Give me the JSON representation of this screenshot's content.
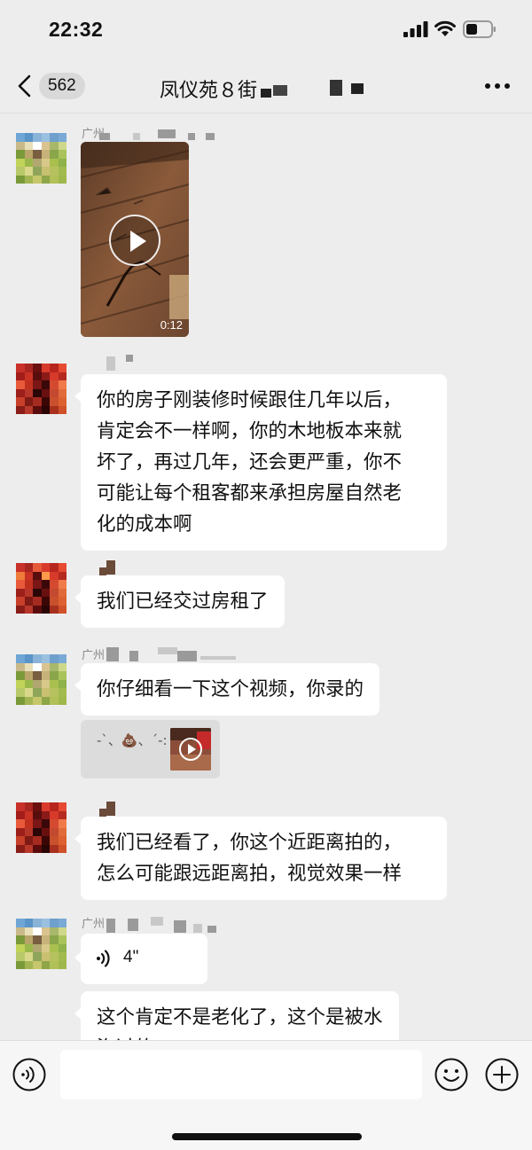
{
  "status_bar": {
    "time": "22:32"
  },
  "header": {
    "unread_count": "562",
    "title": "凤仪苑８街"
  },
  "messages": [
    {
      "kind": "video",
      "sender": "广州",
      "duration": "0:12"
    },
    {
      "kind": "text",
      "lines": [
        "你的房子刚装修时候跟住几年以后，",
        "肯定会不一样啊，你的木地板本来就",
        "坏了，再过几年，还会更严重，你不",
        "可能让每个租客都来承担房屋自然老",
        "化的成本啊"
      ]
    },
    {
      "kind": "text",
      "lines": [
        "我们已经交过房租了"
      ]
    },
    {
      "kind": "text",
      "sender": "广州",
      "lines": [
        "你仔细看一下这个视频，你录的"
      ],
      "quote": "-`、💩、´-:"
    },
    {
      "kind": "text",
      "lines": [
        "我们已经看了，你这个近距离拍的，",
        "怎么可能跟远距离拍，视觉效果一样"
      ]
    },
    {
      "kind": "voice",
      "sender": "广州",
      "duration": "4\""
    },
    {
      "kind": "text",
      "lines": [
        "这个肯定不是老化了，这个是被水",
        "泡过的"
      ]
    }
  ],
  "input": {
    "value": ""
  },
  "colors": {
    "background": "#ededed",
    "bubble": "#ffffff",
    "accent": "#111111"
  },
  "icons": [
    "back-chevron-icon",
    "more-icon",
    "voice-mode-icon",
    "emoji-icon",
    "add-icon",
    "play-icon",
    "voice-wave-icon",
    "signal-icon",
    "wifi-icon",
    "battery-icon"
  ]
}
